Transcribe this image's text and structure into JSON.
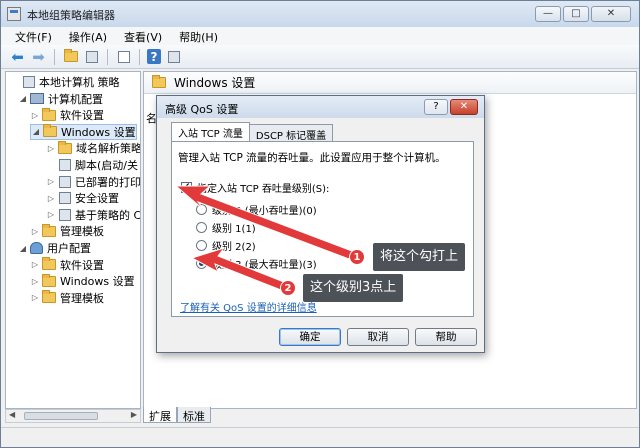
{
  "window": {
    "title": "本地组策略编辑器",
    "min": "—",
    "max": "□",
    "close": "✕"
  },
  "menu": [
    "文件(F)",
    "操作(A)",
    "查看(V)",
    "帮助(H)"
  ],
  "tree": {
    "items": [
      {
        "label": "本地计算机 策略",
        "level": 0,
        "twisty": "",
        "icon": "gen"
      },
      {
        "label": "计算机配置",
        "level": 1,
        "twisty": "◢",
        "icon": "pc"
      },
      {
        "label": "软件设置",
        "level": 2,
        "twisty": "▷",
        "icon": "folder"
      },
      {
        "label": "Windows 设置",
        "level": 2,
        "twisty": "◢",
        "icon": "folder",
        "selected": true
      },
      {
        "label": "域名解析策略",
        "level": 3,
        "twisty": "▷",
        "icon": "folder"
      },
      {
        "label": "脚本(启动/关",
        "level": 3,
        "twisty": "",
        "icon": "gen"
      },
      {
        "label": "已部署的打印",
        "level": 3,
        "twisty": "▷",
        "icon": "gen"
      },
      {
        "label": "安全设置",
        "level": 3,
        "twisty": "▷",
        "icon": "gen"
      },
      {
        "label": "基于策略的 C",
        "level": 3,
        "twisty": "▷",
        "icon": "gen"
      },
      {
        "label": "管理模板",
        "level": 2,
        "twisty": "▷",
        "icon": "folder"
      },
      {
        "label": "用户配置",
        "level": 1,
        "twisty": "◢",
        "icon": "user"
      },
      {
        "label": "软件设置",
        "level": 2,
        "twisty": "▷",
        "icon": "folder"
      },
      {
        "label": "Windows 设置",
        "level": 2,
        "twisty": "▷",
        "icon": "folder"
      },
      {
        "label": "管理模板",
        "level": 2,
        "twisty": "▷",
        "icon": "folder"
      }
    ]
  },
  "right_pane": {
    "header": "Windows 设置",
    "side_text": "名"
  },
  "bottom_tabs": [
    "扩展",
    "标准"
  ],
  "dialog": {
    "title": "高级 QoS 设置",
    "help": "?",
    "close": "✕",
    "tabs": [
      "入站 TCP 流量",
      "DSCP 标记覆盖"
    ],
    "description": "管理入站 TCP 流量的吞吐量。此设置应用于整个计算机。",
    "checkbox_label": "指定入站 TCP 吞吐量级别(S):",
    "checkbox_checked": true,
    "radios": [
      {
        "label": "级别 0 (最小吞吐量)(0)",
        "selected": false
      },
      {
        "label": "级别 1(1)",
        "selected": false
      },
      {
        "label": "级别 2(2)",
        "selected": false
      },
      {
        "label": "级别 3 (最大吞吐量)(3)",
        "selected": true
      }
    ],
    "link": "了解有关 QoS 设置的详细信息",
    "buttons": {
      "ok": "确定",
      "cancel": "取消",
      "help": "帮助"
    }
  },
  "annotations": {
    "badge1": "1",
    "callout1": "将这个勾打上",
    "badge2": "2",
    "callout2": "这个级别3点上",
    "arrow_color": "#e23a3a"
  }
}
